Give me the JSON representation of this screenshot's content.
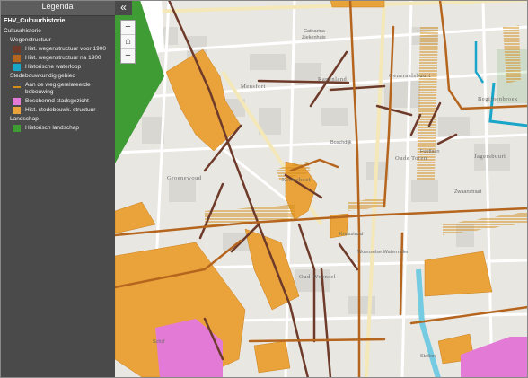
{
  "legend": {
    "title": "Legenda",
    "layer": "EHV_Cultuurhistorie",
    "group": "Cultuurhistorie",
    "sections": [
      {
        "title": "Wegenstructuur",
        "items": [
          {
            "label": "Hist. wegenstructuur voor 1900",
            "color": "#6e3a2a",
            "kind": "fill"
          },
          {
            "label": "Hist. wegenstructuur na 1900",
            "color": "#b5651d",
            "kind": "fill"
          },
          {
            "label": "Historische waterloop",
            "color": "#1aa6c8",
            "kind": "fill"
          }
        ]
      },
      {
        "title": "Stedebouwkundig gebied",
        "items": [
          {
            "label": "Aan de weg gerelateerde bebouwing",
            "color": "#d38e1a",
            "kind": "hatch"
          },
          {
            "label": "Beschermd stadsgezicht",
            "color": "#e37bd6",
            "kind": "fill"
          },
          {
            "label": "Hist. stedebouwk. structuur",
            "color": "#e9a33a",
            "kind": "fill"
          }
        ]
      },
      {
        "title": "Landschap",
        "items": [
          {
            "label": "Historisch landschap",
            "color": "#3f9c35",
            "kind": "fill"
          }
        ]
      }
    ]
  },
  "controls": {
    "collapse_icon": "«",
    "zoom_in": "+",
    "home_icon": "⌂",
    "zoom_out": "−"
  },
  "map": {
    "labels": {
      "catharina": "Catharina",
      "ziekenhuis": "Ziekenhuis",
      "mensfort": "Mensfort",
      "rapenland": "Rapenland",
      "generaalsbuurt": "Generaalsbuurt",
      "jagersbuurt": "Jagersbuurt",
      "oude_toren": "Oude Toren",
      "zwaanstraat": "Zwaanstraat",
      "fuutlaan": "Fuutlaan",
      "boschdijk": "Boschdijk",
      "grenswoud": "Groenewoud",
      "kronehoef": "Kronehoef",
      "oud_woensel": "Oud-Woensel",
      "woenselse_watermolen": "Woenselse Watermolen",
      "schijf": "Schijf",
      "begijnenbroek": "Begijnenbroek",
      "kruis": "Kruisstraat",
      "station": "Station"
    }
  }
}
